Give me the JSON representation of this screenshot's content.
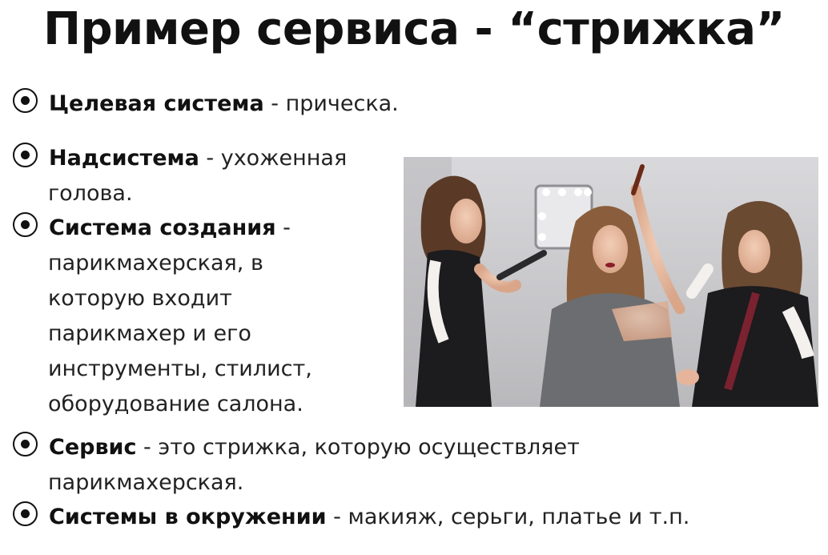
{
  "title": "Пример сервиса - “стрижка”",
  "items": [
    {
      "term": "Целевая система",
      "rest": " - прическа.",
      "continuation": []
    },
    {
      "term": "Надсистема",
      "rest": " - ухоженная",
      "continuation": [
        "голова."
      ]
    },
    {
      "term": "Система создания",
      "rest": " -",
      "continuation": [
        "парикмахерская, в",
        "которую входит",
        "парикмахер и его",
        "инструменты, стилист,",
        "оборудование салона."
      ]
    },
    {
      "term": "Сервис",
      "rest": " - это стрижка, которую осуществляет",
      "continuation": [
        "парикмахерская."
      ]
    },
    {
      "term": "Системы в окружении",
      "rest": " - макияж, серьги, платье и т.п.",
      "continuation": []
    }
  ],
  "bullet_icon": "radio-bullet-icon",
  "photo": {
    "icon": "hair-salon-photo-icon"
  }
}
